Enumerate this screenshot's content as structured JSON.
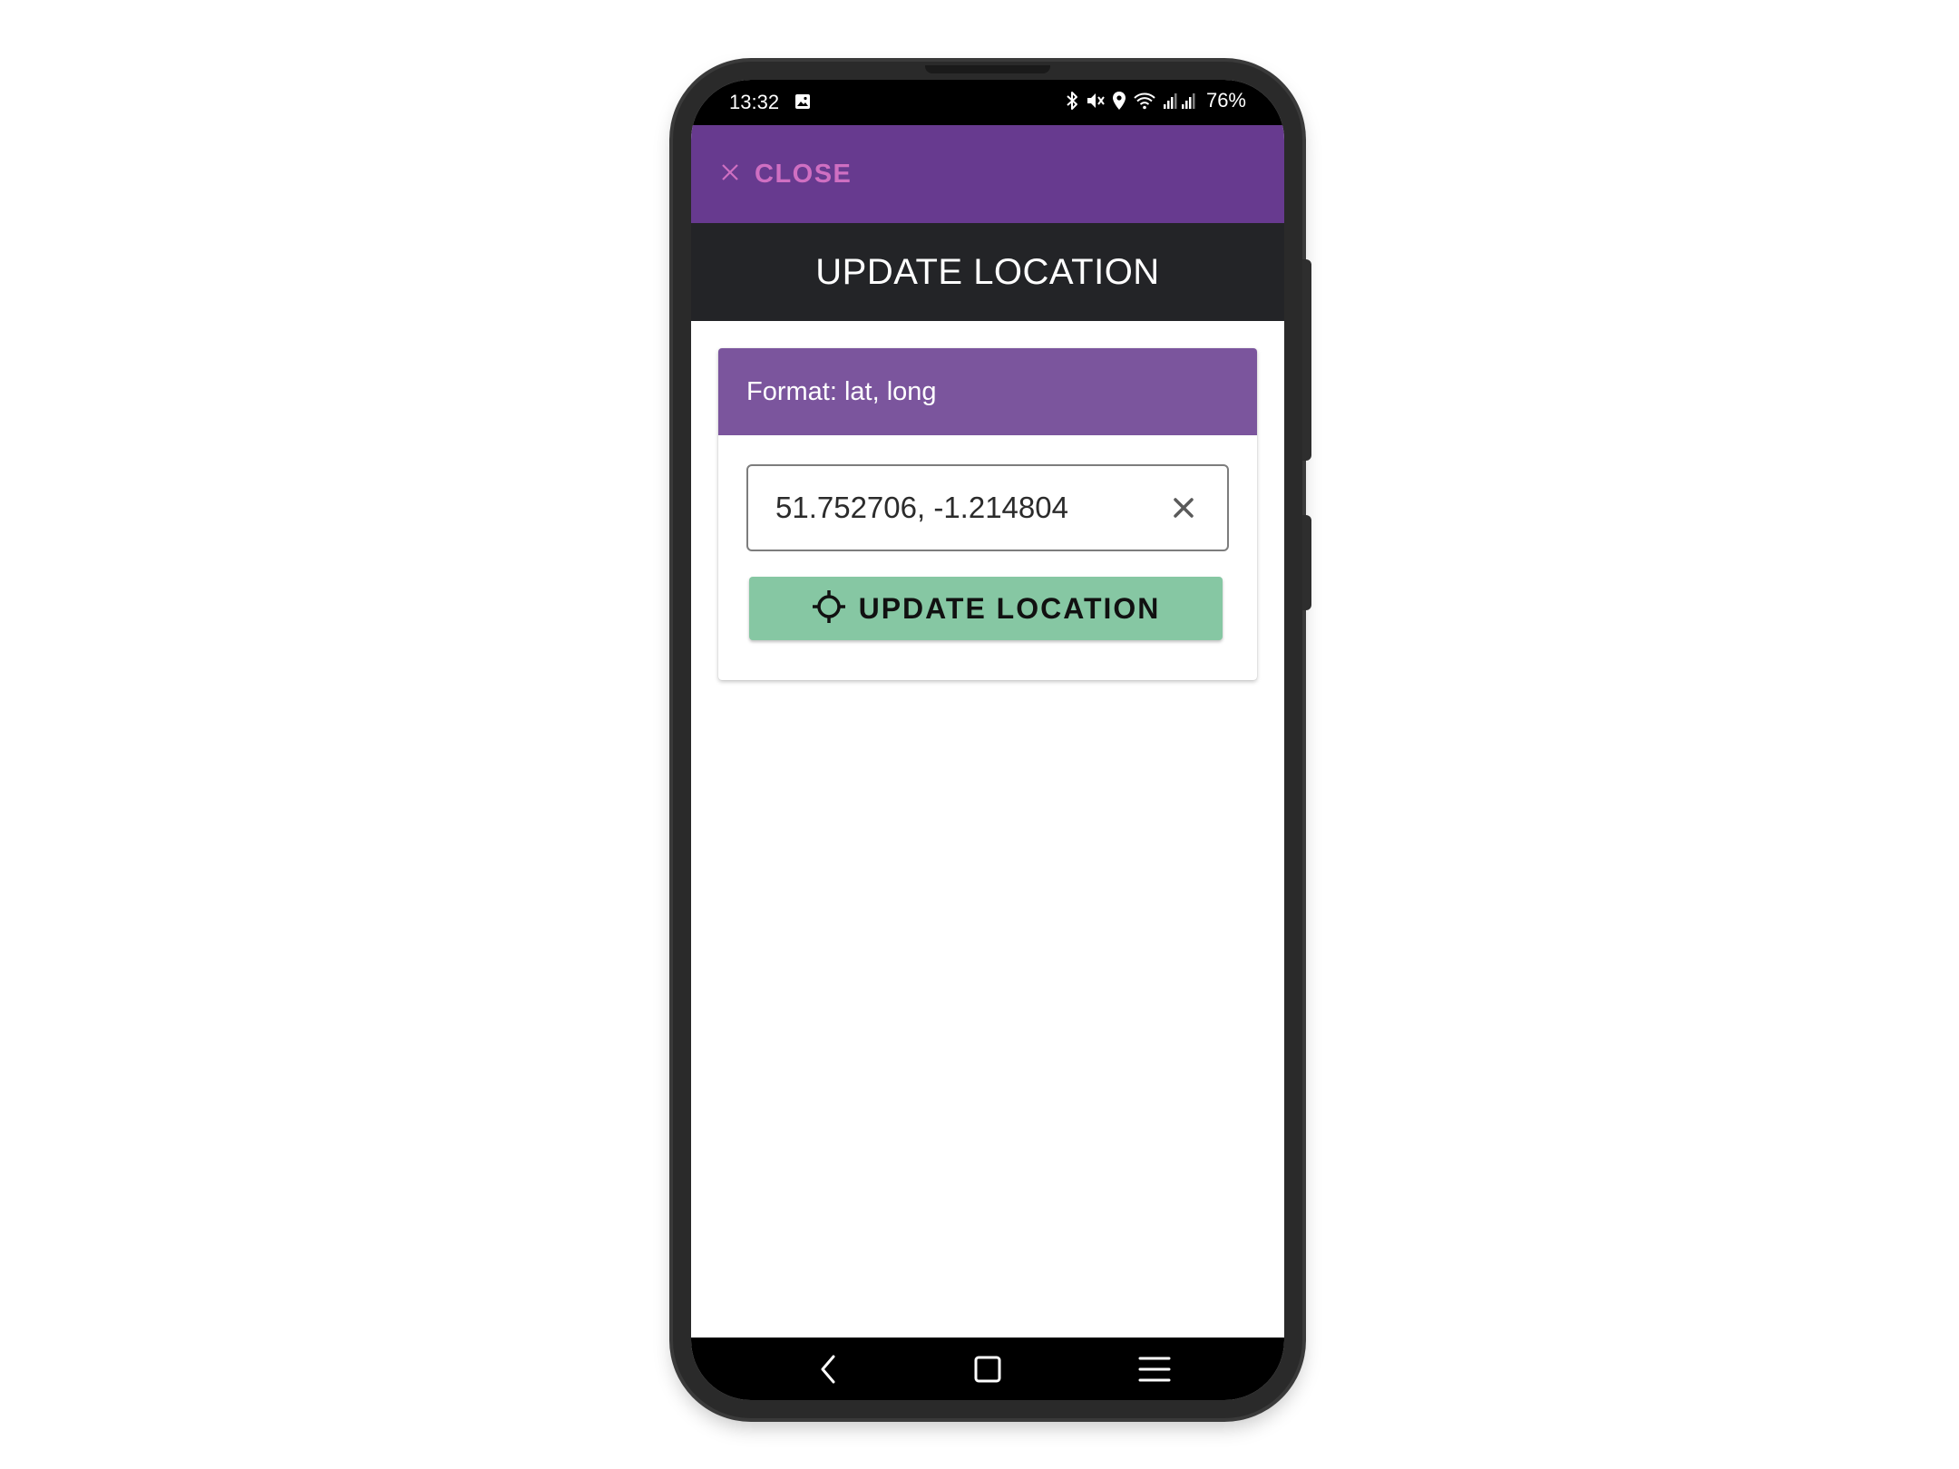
{
  "status_bar": {
    "time": "13:32",
    "battery": "76%",
    "icons": [
      "image-icon",
      "bluetooth-icon",
      "mute-icon",
      "location-icon",
      "wifi-icon",
      "signal-icon"
    ]
  },
  "top_bar": {
    "close_label": "CLOSE",
    "accent_color": "#cf6fc2",
    "background_color": "#673a8f"
  },
  "title_bar": {
    "title": "UPDATE LOCATION"
  },
  "card": {
    "header": "Format: lat, long",
    "input_value": "51.752706, -1.214804",
    "button_label": "UPDATE LOCATION",
    "button_color": "#86c7a3"
  },
  "nav_bar": {
    "icons": [
      "back-icon",
      "home-icon",
      "recents-icon"
    ]
  }
}
